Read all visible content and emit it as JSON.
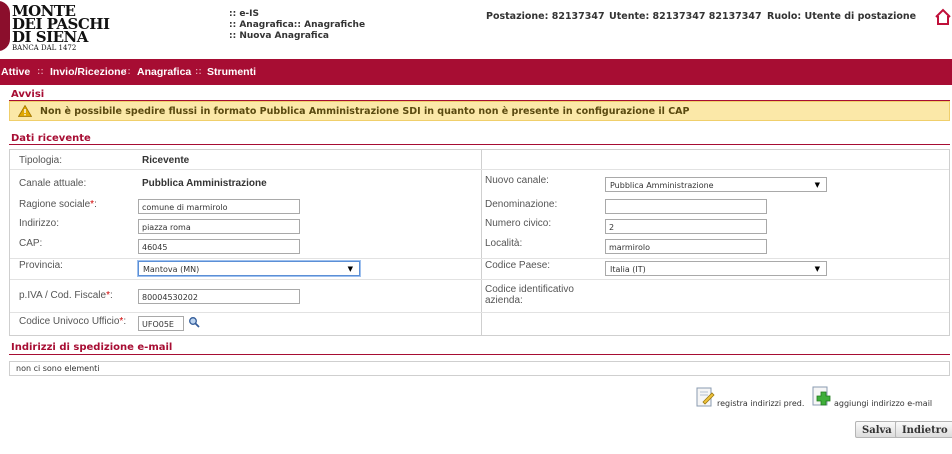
{
  "brand": {
    "line1": "MONTE",
    "line2": "DEI PASCHI",
    "line3": "DI SIENA",
    "line4": "BANCA DAL 1472",
    "color": "#a70d33"
  },
  "breadcrumbs": {
    "l1": ":: e-IS",
    "l2": ":: Anagrafica:: Anagrafiche",
    "l3": ":: Nuova Anagrafica"
  },
  "header": {
    "postazione": "Postazione: 82137347",
    "utente": "Utente: 82137347 82137347",
    "ruolo": "Ruolo: Utente di postazione",
    "home_icon": "home-icon"
  },
  "nav": {
    "items": [
      "Attive",
      "Invio/Ricezione",
      "Anagrafica",
      "Strumenti"
    ],
    "separator": "::"
  },
  "avvisi": {
    "title": "Avvisi",
    "message": "Non è possibile spedire flussi in formato Pubblica Amministrazione SDI in quanto non è presente in configurazione il CAP",
    "icon": "warning-icon"
  },
  "dati": {
    "title": "Dati ricevente",
    "tipologia_label": "Tipologia:",
    "tipologia_value": "Ricevente",
    "canale_label": "Canale attuale:",
    "canale_value": "Pubblica Amministrazione",
    "nuovo_canale_label": "Nuovo canale:",
    "nuovo_canale_value": "Pubblica Amministrazione",
    "ragione_label": "Ragione sociale",
    "ragione_value": "comune di marmirolo",
    "denominazione_label": "Denominazione:",
    "denominazione_value": "",
    "indirizzo_label": "Indirizzo:",
    "indirizzo_value": "piazza roma",
    "civico_label": "Numero civico:",
    "civico_value": "2",
    "cap_label": "CAP:",
    "cap_value": "46045",
    "localita_label": "Località:",
    "localita_value": "marmirolo",
    "provincia_label": "Provincia:",
    "provincia_value": "Mantova (MN)",
    "codice_paese_label": "Codice Paese:",
    "codice_paese_value": "Italia (IT)",
    "piva_label": "p.IVA / Cod. Fiscale",
    "piva_value": "80004530202",
    "codice_id_label_1": "Codice identificativo",
    "codice_id_label_2": "azienda:",
    "cuu_label": "Codice Univoco Ufficio",
    "cuu_value": "UFO05E",
    "required_mark": "*",
    "colon": ":"
  },
  "email": {
    "title": "Indirizzi di spedizione e-mail",
    "empty_text": "non ci sono elementi",
    "registra_label": "registra indirizzi pred.",
    "aggiungi_label": "aggiungi indirizzo e-mail"
  },
  "buttons": {
    "salva": "Salva",
    "indietro": "Indietro"
  }
}
